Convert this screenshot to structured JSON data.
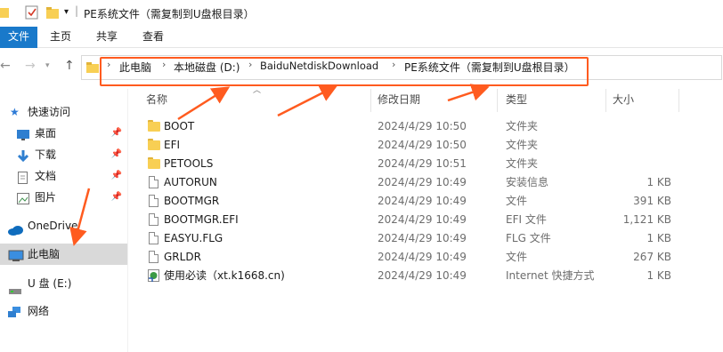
{
  "window": {
    "title": "PE系统文件（需复制到U盘根目录）"
  },
  "ribbon": {
    "tabs": [
      "文件",
      "主页",
      "共享",
      "查看"
    ]
  },
  "address": {
    "crumbs": [
      "此电脑",
      "本地磁盘 (D:)",
      "BaiduNetdiskDownload",
      "PE系统文件（需复制到U盘根目录）"
    ]
  },
  "sidebar": {
    "quick_access": "快速访问",
    "items": [
      {
        "label": "桌面",
        "icon": "desktop-icon",
        "pinned": true
      },
      {
        "label": "下载",
        "icon": "download-icon",
        "pinned": true
      },
      {
        "label": "文档",
        "icon": "document-icon",
        "pinned": true
      },
      {
        "label": "图片",
        "icon": "picture-icon",
        "pinned": true
      }
    ],
    "onedrive": "OneDrive",
    "this_pc": "此电脑",
    "usb": "U 盘 (E:)",
    "network": "网络"
  },
  "columns": {
    "name": "名称",
    "date": "修改日期",
    "type": "类型",
    "size": "大小"
  },
  "files": [
    {
      "name": "BOOT",
      "date": "2024/4/29 10:50",
      "type": "文件夹",
      "size": "",
      "icon": "folder"
    },
    {
      "name": "EFI",
      "date": "2024/4/29 10:50",
      "type": "文件夹",
      "size": "",
      "icon": "folder"
    },
    {
      "name": "PETOOLS",
      "date": "2024/4/29 10:51",
      "type": "文件夹",
      "size": "",
      "icon": "folder"
    },
    {
      "name": "AUTORUN",
      "date": "2024/4/29 10:49",
      "type": "安装信息",
      "size": "1 KB",
      "icon": "file"
    },
    {
      "name": "BOOTMGR",
      "date": "2024/4/29 10:49",
      "type": "文件",
      "size": "391 KB",
      "icon": "file"
    },
    {
      "name": "BOOTMGR.EFI",
      "date": "2024/4/29 10:49",
      "type": "EFI 文件",
      "size": "1,121 KB",
      "icon": "file"
    },
    {
      "name": "EASYU.FLG",
      "date": "2024/4/29 10:49",
      "type": "FLG 文件",
      "size": "1 KB",
      "icon": "file"
    },
    {
      "name": "GRLDR",
      "date": "2024/4/29 10:49",
      "type": "文件",
      "size": "267 KB",
      "icon": "file"
    },
    {
      "name": "使用必读（xt.k1668.cn)",
      "date": "2024/4/29 10:49",
      "type": "Internet 快捷方式",
      "size": "1 KB",
      "icon": "link"
    }
  ],
  "colors": {
    "ribbon_file_tab": "#1979ca",
    "annotation": "#ff5b1f",
    "folder": "#f8cf54"
  }
}
